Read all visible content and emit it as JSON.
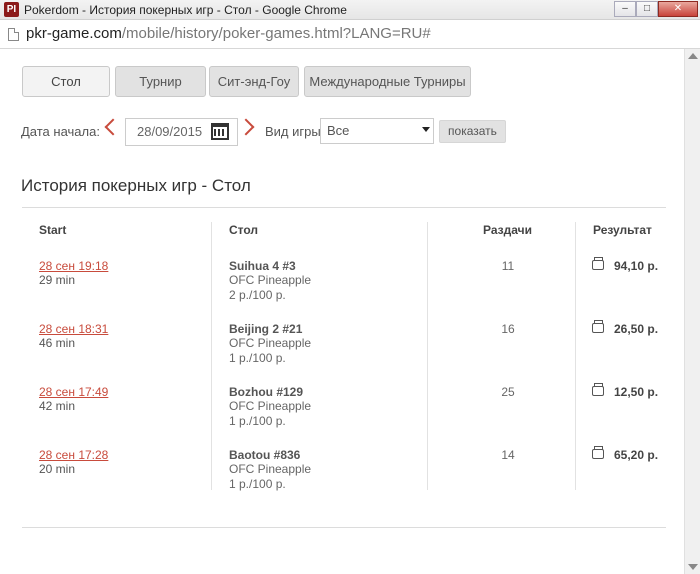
{
  "window": {
    "app_icon": "PI",
    "title": "Pokerdom - История покерных игр - Стол - Google Chrome",
    "controls": [
      "–",
      "□",
      "✕"
    ]
  },
  "browser": {
    "url_host": "pkr-game.com",
    "url_path": "/mobile/history/poker-games.html?LANG=RU#"
  },
  "tabs": [
    {
      "label": "Стол",
      "active": true
    },
    {
      "label": "Турнир",
      "active": false
    },
    {
      "label": "Сит-энд-Гоу",
      "active": false
    },
    {
      "label": "Международные Турниры",
      "active": false
    }
  ],
  "filters": {
    "start_date_label": "Дата начала:",
    "start_date_value": "28/09/2015",
    "game_type_label": "Вид игры:",
    "game_type_value": "Все",
    "show_button": "показать"
  },
  "heading": "История покерных игр - Стол",
  "table": {
    "columns": [
      "Start",
      "Стол",
      "Раздачи",
      "Результат"
    ],
    "rows": [
      {
        "date": "28 сен 19:18",
        "duration": "29 min",
        "table": "Suihua 4 #3",
        "game": "OFC Pineapple",
        "stakes": "2 р./100 р.",
        "hands": "11",
        "result": "94,10 р."
      },
      {
        "date": "28 сен 18:31",
        "duration": "46 min",
        "table": "Beijing 2 #21",
        "game": "OFC Pineapple",
        "stakes": "1 р./100 р.",
        "hands": "16",
        "result": "26,50 р."
      },
      {
        "date": "28 сен 17:49",
        "duration": "42 min",
        "table": "Bozhou #129",
        "game": "OFC Pineapple",
        "stakes": "1 р./100 р.",
        "hands": "25",
        "result": "12,50 р."
      },
      {
        "date": "28 сен 17:28",
        "duration": "20 min",
        "table": "Baotou #836",
        "game": "OFC Pineapple",
        "stakes": "1 р./100 р.",
        "hands": "14",
        "result": "65,20 р."
      }
    ]
  },
  "colors": {
    "accent_red": "#c84b3c",
    "tab_bg": "#e2e2e2"
  }
}
